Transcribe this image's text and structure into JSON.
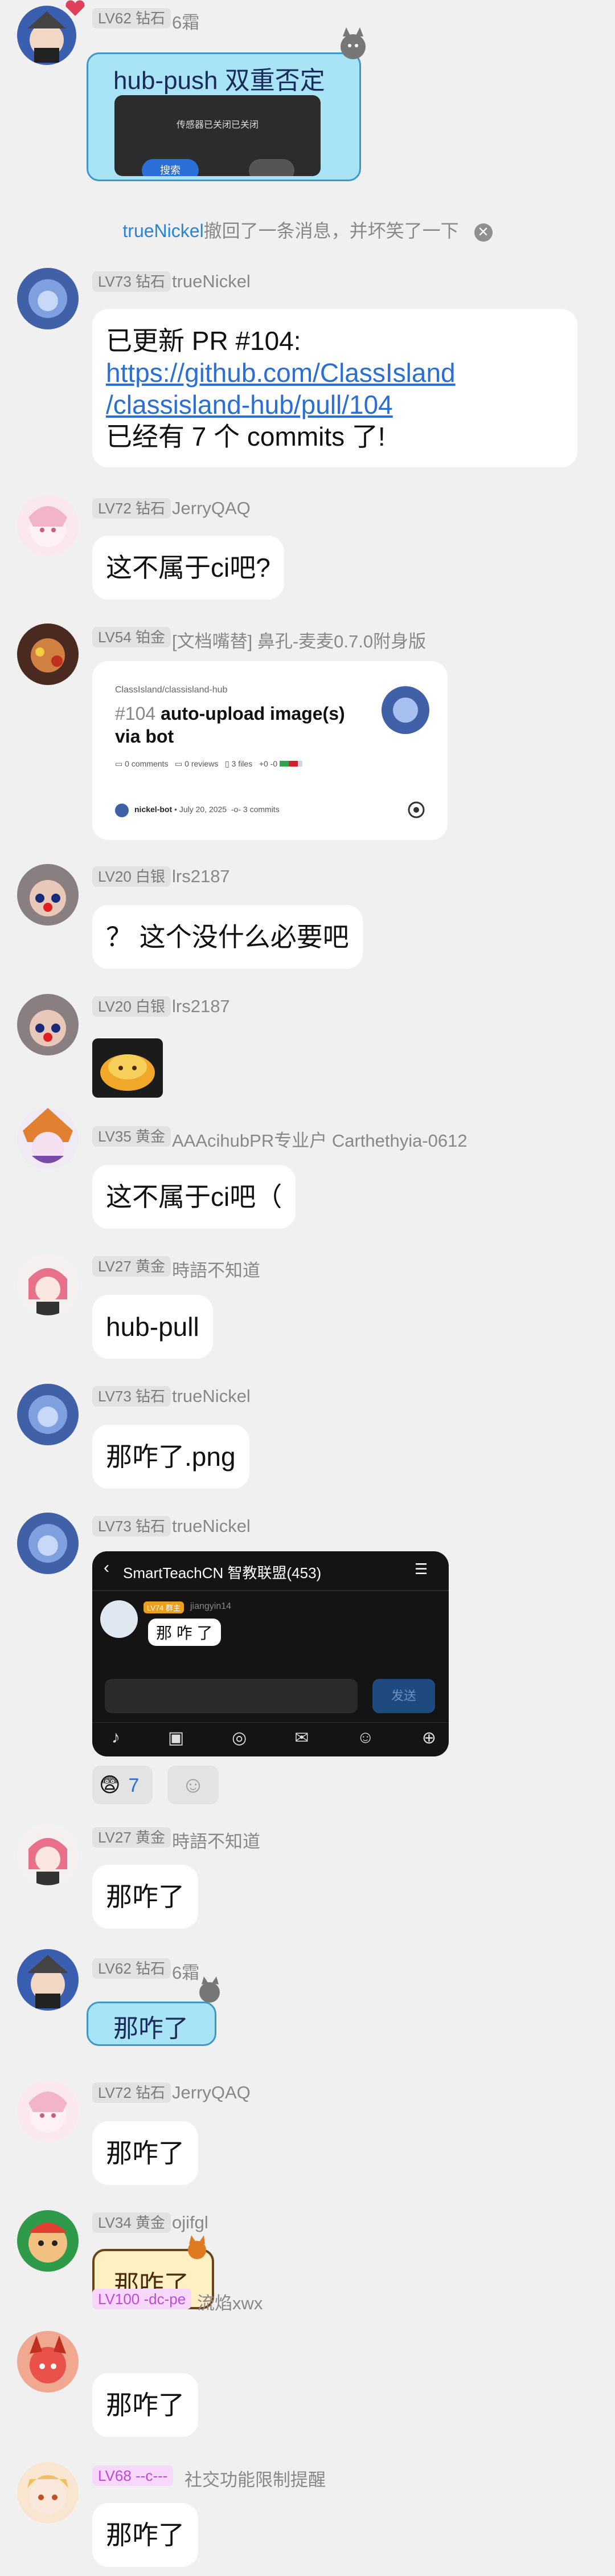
{
  "colors": {
    "background": "#f0f0f0",
    "bubble": "#ffffff",
    "link": "#2a6fd6",
    "recall_name": "#2a84d6",
    "deco_bubble": "#a9e4f6",
    "deco_border": "#3c98c8",
    "gold_bubble": "#fff0c4"
  },
  "top_message": {
    "badge": "LV62 钻石",
    "name": "6霜",
    "text": "hub-push 双重否定",
    "screenshot": {
      "text": "传感器已关闭已关闭",
      "button": "搜索"
    }
  },
  "system_notice": {
    "name": "trueNickel",
    "text": "撤回了一条消息，并坏笑了一下",
    "close_icon": "close-circle-icon"
  },
  "messages": [
    {
      "badge": "LV73 钻石",
      "name": "trueNickel",
      "line1": "已更新 PR #104:",
      "link1": "https://github.com/ClassIsland",
      "link2": "/classisland-hub/pull/104",
      "line2": "已经有 7 个 commits 了!"
    },
    {
      "badge": "LV72 钻石",
      "name": "JerryQAQ",
      "text": "这不属于ci吧?"
    },
    {
      "badge": "LV54 铂金",
      "name": "[文档嘴替] 鼻孔-麦麦0.7.0附身版",
      "card": {
        "repo": "ClassIsland/classisland-hub",
        "number": "#104",
        "title": "auto-upload image(s) via bot",
        "comments": "0 comments",
        "reviews": "0 reviews",
        "files": "3 files",
        "diff": "+0 -0",
        "author": "nickel-bot",
        "date": "July 20, 2025",
        "commits": "3 commits"
      }
    },
    {
      "badge": "LV20 白银",
      "name": "lrs2187",
      "text": "？ 这个没什么必要吧"
    },
    {
      "badge": "LV20 白银",
      "name": "lrs2187",
      "sticker": "golden-blob-sticker"
    },
    {
      "badge": "LV35 黄金",
      "name": "AAAcihubPR专业户 Carthethyia-0612",
      "text": "这不属于ci吧（"
    },
    {
      "badge": "LV27 黄金",
      "name": "時語不知道",
      "text": "hub-pull"
    },
    {
      "badge": "LV73 钻石",
      "name": "trueNickel",
      "text": "那咋了.png"
    },
    {
      "badge": "LV73 钻石",
      "name": "trueNickel",
      "phone": {
        "title": "SmartTeachCN 智教联盟(453)",
        "inner_badge": "LV74 群主",
        "inner_name": "jiangyin14",
        "inner_text": "那 咋 了",
        "send": "发送"
      },
      "reaction": {
        "emoji": "😨",
        "count": "7"
      }
    },
    {
      "badge": "LV27 黄金",
      "name": "時語不知道",
      "text": "那咋了"
    },
    {
      "badge": "LV62 钻石",
      "name": "6霜",
      "text": "那咋了"
    },
    {
      "badge": "LV72 钻石",
      "name": "JerryQAQ",
      "text": "那咋了"
    },
    {
      "badge": "LV34 黄金",
      "name": "ojifgl",
      "text": "那咋了"
    },
    {
      "badge": "LV100 -dc-pe",
      "name": "流焰xwx",
      "text": "那咋了"
    },
    {
      "badge": "LV68 --c---",
      "name": "社交功能限制提醒",
      "text": "那咋了"
    }
  ]
}
